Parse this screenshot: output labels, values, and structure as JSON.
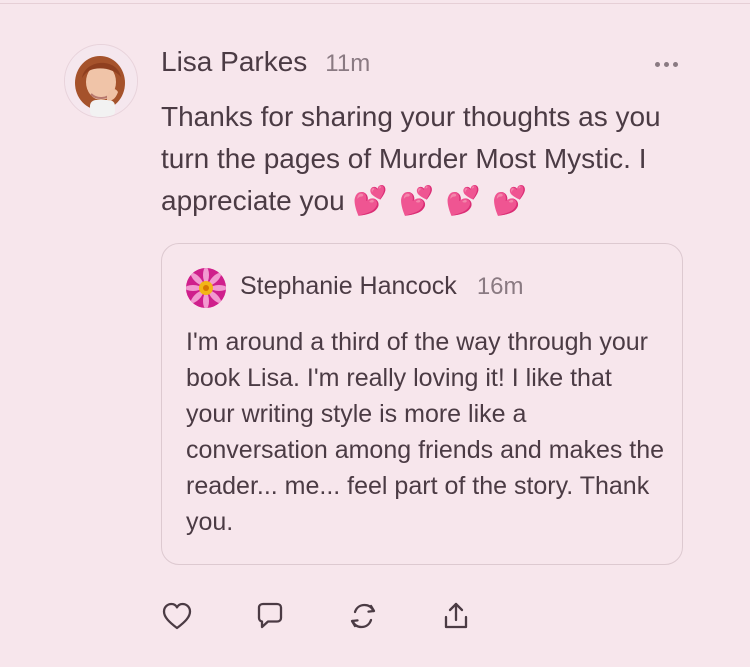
{
  "post": {
    "author": "Lisa Parkes",
    "time": "11m",
    "text": "Thanks for sharing your thoughts as you turn the pages of Murder Most Mystic. I appreciate you ",
    "emoji": "💕 💕 💕 💕",
    "quoted": {
      "author": "Stephanie Hancock",
      "time": "16m",
      "text": "I'm around a third of the way through your book Lisa. I'm really loving it! I like that your writing style is more like a conversation among friends and makes the reader... me... feel part of the story. Thank you."
    }
  },
  "icons": {
    "more": "more-icon",
    "like": "heart-icon",
    "reply": "speech-bubble-icon",
    "restack": "restack-icon",
    "share": "share-icon"
  },
  "colors": {
    "background": "#f7e6ec",
    "text": "#4b3b44",
    "muted": "#8a7a82",
    "heart_emoji": "#ea3f9a",
    "quote_border": "#ddc9d0"
  }
}
